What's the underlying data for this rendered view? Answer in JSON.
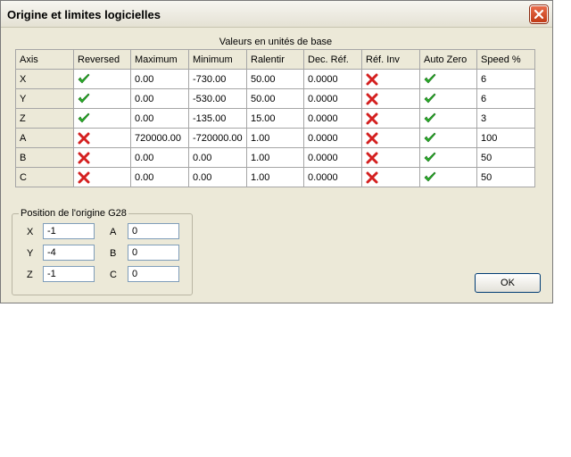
{
  "window": {
    "title": "Origine et limites logicielles"
  },
  "table": {
    "caption": "Valeurs en unités de base",
    "headers": [
      "Axis",
      "Reversed",
      "Maximum",
      "Minimum",
      "Ralentir",
      "Dec. Réf.",
      "Réf. Inv",
      "Auto Zero",
      "Speed %"
    ],
    "rows": [
      {
        "axis": "X",
        "reversed": "check-icon",
        "maximum": "0.00",
        "minimum": "-730.00",
        "ralentir": "50.00",
        "dec_ref": "0.0000",
        "ref_inv": "cross-icon",
        "auto_zero": "check-icon",
        "speed": "6"
      },
      {
        "axis": "Y",
        "reversed": "check-icon",
        "maximum": "0.00",
        "minimum": "-530.00",
        "ralentir": "50.00",
        "dec_ref": "0.0000",
        "ref_inv": "cross-icon",
        "auto_zero": "check-icon",
        "speed": "6"
      },
      {
        "axis": "Z",
        "reversed": "check-icon",
        "maximum": "0.00",
        "minimum": "-135.00",
        "ralentir": "15.00",
        "dec_ref": "0.0000",
        "ref_inv": "cross-icon",
        "auto_zero": "check-icon",
        "speed": "3"
      },
      {
        "axis": "A",
        "reversed": "cross-icon",
        "maximum": "720000.00",
        "minimum": "-720000.00",
        "ralentir": "1.00",
        "dec_ref": "0.0000",
        "ref_inv": "cross-icon",
        "auto_zero": "check-icon",
        "speed": "100"
      },
      {
        "axis": "B",
        "reversed": "cross-icon",
        "maximum": "0.00",
        "minimum": "0.00",
        "ralentir": "1.00",
        "dec_ref": "0.0000",
        "ref_inv": "cross-icon",
        "auto_zero": "check-icon",
        "speed": "50"
      },
      {
        "axis": "C",
        "reversed": "cross-icon",
        "maximum": "0.00",
        "minimum": "0.00",
        "ralentir": "1.00",
        "dec_ref": "0.0000",
        "ref_inv": "cross-icon",
        "auto_zero": "check-icon",
        "speed": "50"
      }
    ]
  },
  "g28": {
    "label": "Position de l'origine G28",
    "fields": [
      {
        "label": "X",
        "value": "-1"
      },
      {
        "label": "Y",
        "value": "-4"
      },
      {
        "label": "Z",
        "value": "-1"
      },
      {
        "label": "A",
        "value": "0"
      },
      {
        "label": "B",
        "value": "0"
      },
      {
        "label": "C",
        "value": "0"
      }
    ]
  },
  "buttons": {
    "ok": "OK"
  },
  "colors": {
    "check": "#2bb52b",
    "cross": "#d42020",
    "close": "#d4502a"
  }
}
